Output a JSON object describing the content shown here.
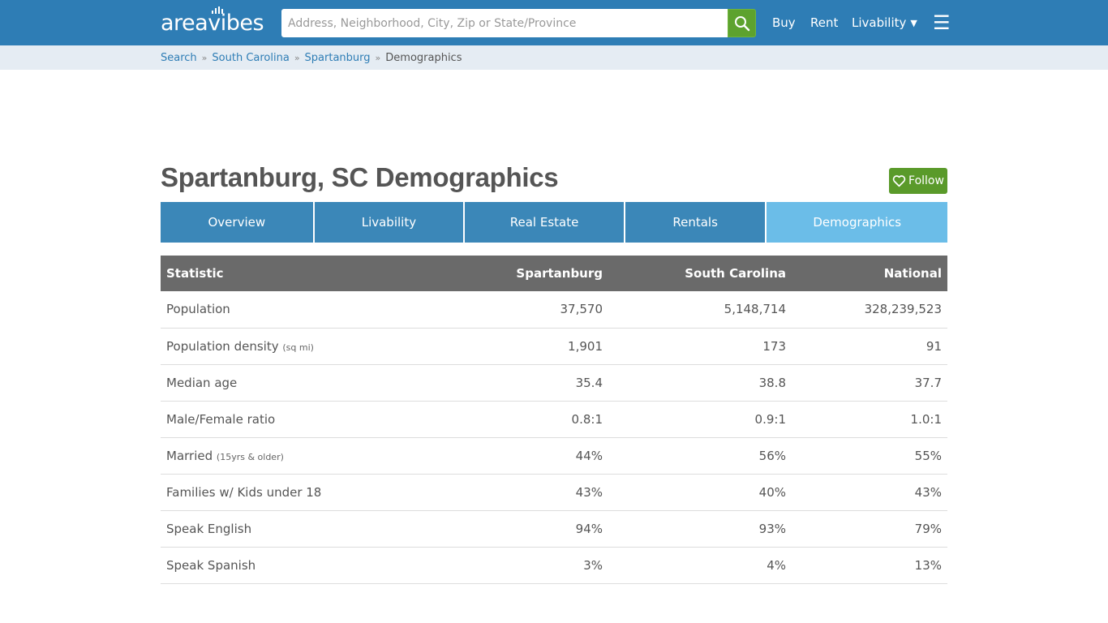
{
  "header": {
    "logo_text_left": "area",
    "logo_text_v": "v",
    "logo_text_right": "ibes",
    "search_placeholder": "Address, Neighborhood, City, Zip or State/Province",
    "search_value": "",
    "search_icon": "search-icon",
    "nav": {
      "buy": "Buy",
      "rent": "Rent",
      "livability": "Livability",
      "livability_caret": "▼",
      "menu_icon": "☰"
    },
    "colors": {
      "bar": "#2e7db5",
      "search_button": "#5da22e"
    }
  },
  "breadcrumb": {
    "items": [
      "Search",
      "South Carolina",
      "Spartanburg"
    ],
    "current": "Demographics",
    "separator": "»"
  },
  "page": {
    "title": "Spartanburg, SC Demographics",
    "follow_label": "Follow",
    "follow_icon": "heart-outline-icon"
  },
  "tabs": [
    {
      "label": "Overview",
      "active": false
    },
    {
      "label": "Livability",
      "active": false
    },
    {
      "label": "Real Estate",
      "active": false
    },
    {
      "label": "Rentals",
      "active": false
    },
    {
      "label": "Demographics",
      "active": true
    }
  ],
  "table": {
    "headers": [
      "Statistic",
      "Spartanburg",
      "South Carolina",
      "National"
    ],
    "rows": [
      {
        "label": "Population",
        "note": "",
        "values": [
          "37,570",
          "5,148,714",
          "328,239,523"
        ]
      },
      {
        "label": "Population density",
        "note": "(sq mi)",
        "values": [
          "1,901",
          "173",
          "91"
        ]
      },
      {
        "label": "Median age",
        "note": "",
        "values": [
          "35.4",
          "38.8",
          "37.7"
        ]
      },
      {
        "label": "Male/Female ratio",
        "note": "",
        "values": [
          "0.8:1",
          "0.9:1",
          "1.0:1"
        ]
      },
      {
        "label": "Married",
        "note": "(15yrs & older)",
        "values": [
          "44%",
          "56%",
          "55%"
        ]
      },
      {
        "label": "Families w/ Kids under 18",
        "note": "",
        "values": [
          "43%",
          "40%",
          "43%"
        ]
      },
      {
        "label": "Speak English",
        "note": "",
        "values": [
          "94%",
          "93%",
          "79%"
        ]
      },
      {
        "label": "Speak Spanish",
        "note": "",
        "values": [
          "3%",
          "4%",
          "13%"
        ]
      }
    ]
  }
}
